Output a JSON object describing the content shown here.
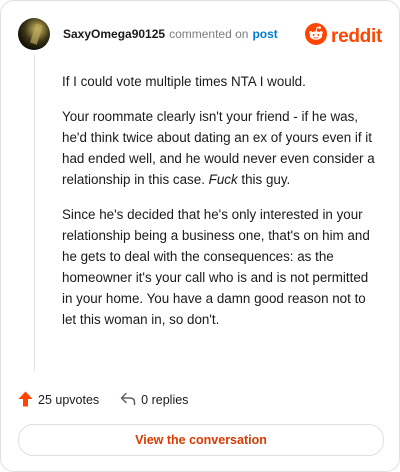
{
  "header": {
    "username": "SaxyOmega90125",
    "action": "commented on",
    "post_link": "post",
    "brand": "reddit"
  },
  "comment": {
    "paragraph_1": "If I could vote multiple times NTA I would.",
    "paragraph_2_main": "Your roommate clearly isn't your friend - if he was, he'd think twice about dating an ex of yours even if it had ended well, and he would never even consider a relationship in this case. ",
    "paragraph_2_italic": "Fuck",
    "paragraph_2_end": " this guy.",
    "paragraph_3": "Since he's decided that he's only interested in your relationship being a business one, that's on him and he gets to deal with the consequences: as the homeowner it's your call who is and is not permitted in your home. You have a damn good reason not to let this woman in, so don't."
  },
  "footer": {
    "upvotes": "25 upvotes",
    "replies": "0 replies"
  },
  "cta": {
    "label": "View the conversation"
  },
  "colors": {
    "reddit_orange": "#ff4500",
    "link_blue": "#0079d3",
    "cta_text": "#d93a00"
  },
  "icons": {
    "upvote": "upvote-arrow-icon",
    "reply": "reply-arrow-icon",
    "brand": "reddit-snoo-icon"
  }
}
